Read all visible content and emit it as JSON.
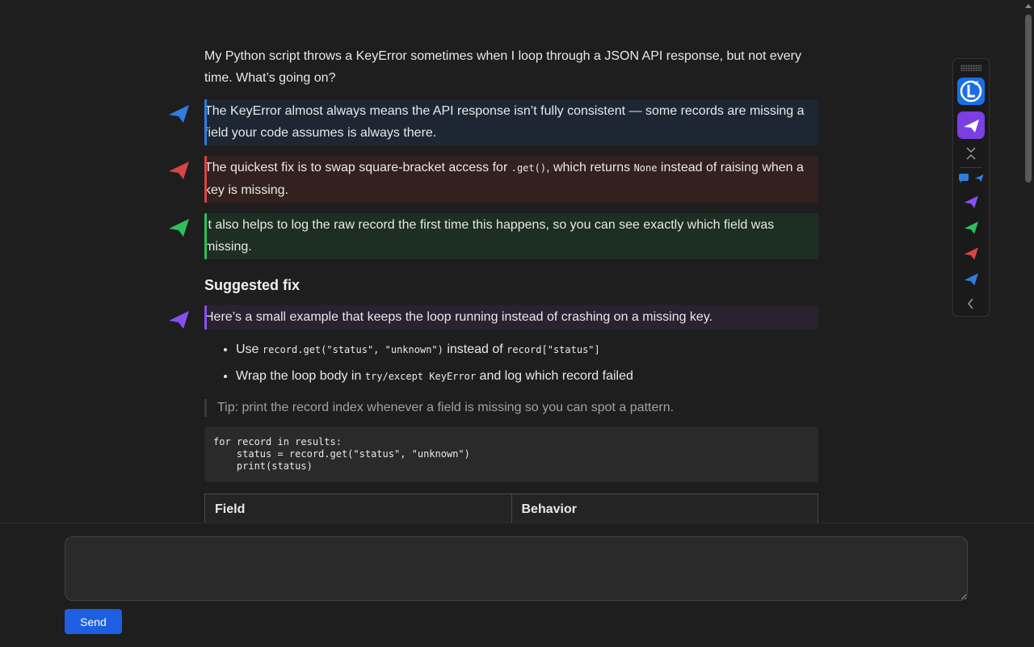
{
  "conversation": {
    "user_message": "My Python script throws a KeyError sometimes when I loop through a JSON API response, but not every time. What’s going on?",
    "segments": [
      {
        "color": "blue",
        "parts": [
          {
            "t": "text",
            "v": "The KeyError almost always means the API response isn’t fully consistent — some records are missing a field your code assumes is always there."
          }
        ]
      },
      {
        "color": "red",
        "parts": [
          {
            "t": "text",
            "v": "The quickest fix is to swap square-bracket access for "
          },
          {
            "t": "code",
            "v": ".get()"
          },
          {
            "t": "text",
            "v": ", which returns "
          },
          {
            "t": "code",
            "v": "None"
          },
          {
            "t": "text",
            "v": " instead of raising when a key is missing."
          }
        ]
      },
      {
        "color": "green",
        "parts": [
          {
            "t": "text",
            "v": "It also helps to log the raw record the first time this happens, so you can see exactly which field was missing."
          }
        ]
      }
    ],
    "heading": "Suggested fix",
    "example_segment": {
      "color": "purple",
      "text": "Here’s a small example that keeps the loop running instead of crashing on a missing key."
    },
    "bullets": [
      [
        {
          "t": "text",
          "v": "Use "
        },
        {
          "t": "code",
          "v": "record.get(\"status\", \"unknown\")"
        },
        {
          "t": "text",
          "v": " instead of "
        },
        {
          "t": "code",
          "v": "record[\"status\"]"
        }
      ],
      [
        {
          "t": "text",
          "v": "Wrap the loop body in "
        },
        {
          "t": "code",
          "v": "try/except KeyError"
        },
        {
          "t": "text",
          "v": " and log which record failed"
        }
      ]
    ],
    "tip": "Tip: print the record index whenever a field is missing so you can spot a pattern.",
    "code_block": "for record in results:\n    status = record.get(\"status\", \"unknown\")\n    print(status)",
    "table": {
      "headers": [
        "Field",
        "Behavior"
      ]
    }
  },
  "sidebar_panel": {
    "icons": [
      "grip-icon",
      "app-logo-icon",
      "compose-icon",
      "collapse-icon",
      "chat-bubble-icon",
      "pen-blue-small-icon",
      "purple-pen-icon",
      "green-pen-icon",
      "red-pen-icon",
      "blue-pen-icon",
      "chevron-left-icon"
    ]
  },
  "composer": {
    "input_value": "",
    "send_label": "Send"
  },
  "colors": {
    "blue": "#2f7de1",
    "red": "#d94444",
    "green": "#2fbf5a",
    "purple": "#8a4ff0",
    "send_button": "#1d5fe0",
    "background": "#1e1e1e"
  }
}
